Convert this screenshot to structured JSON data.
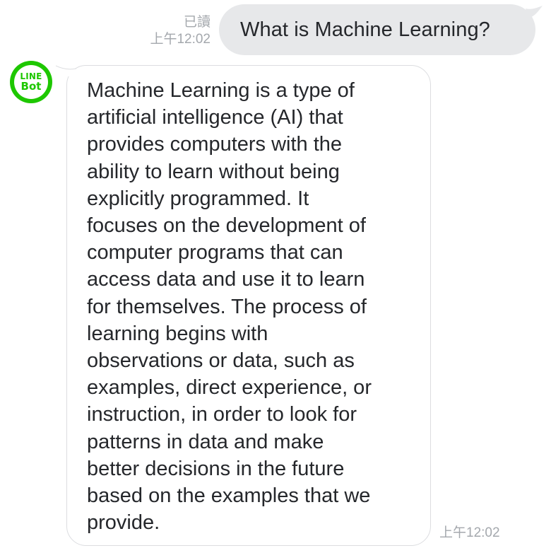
{
  "conversation": {
    "outgoing": {
      "status": "已讀",
      "time": "上午12:02",
      "text": "What is Machine Learning?"
    },
    "incoming": {
      "avatar": {
        "line1": "LINE",
        "line2": "Bot",
        "icon": "line-bot-avatar-icon"
      },
      "text": "Machine Learning is a type of\nartificial intelligence (AI) that\nprovides computers with the\nability to learn without being\nexplicitly programmed. It\nfocuses on the development of\ncomputer programs that can\naccess data and use it to learn\nfor themselves. The process of\nlearning begins with\nobservations or data, such as\nexamples, direct experience, or\ninstruction, in order to look for\npatterns in data and make\nbetter decisions in the future\nbased on the examples that we\nprovide.",
      "time": "上午12:02"
    }
  },
  "colors": {
    "outgoing_bubble": "#e7e8ea",
    "incoming_bubble": "#ffffff",
    "incoming_border": "#dcdde0",
    "avatar_green": "#1ec700",
    "meta_text": "#a4a8ad",
    "message_text": "#25272b"
  }
}
